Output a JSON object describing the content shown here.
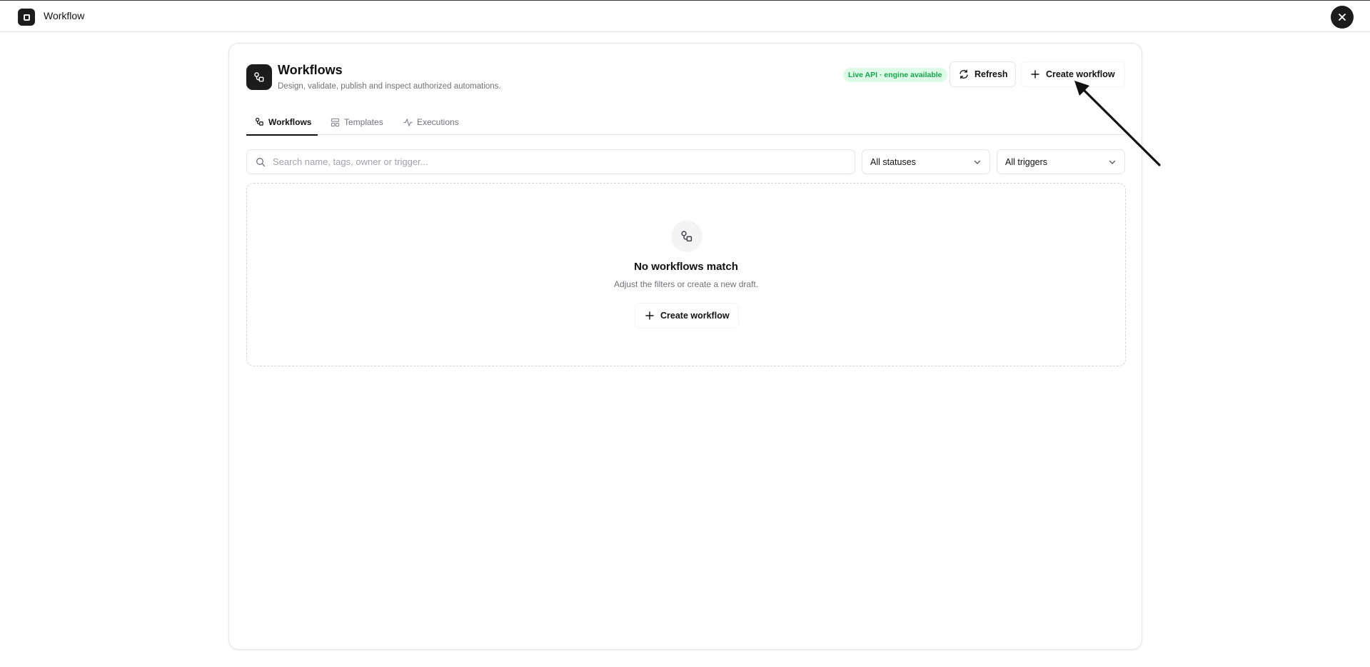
{
  "window": {
    "title": "Workflow",
    "app_icon": "square-icon",
    "close_icon": "close-icon"
  },
  "header": {
    "title": "Workflows",
    "subtitle": "Design, validate, publish and inspect authorized automations.",
    "icon": "workflow-icon",
    "status_badge": "Live API · engine available",
    "refresh_label": "Refresh",
    "create_label": "Create workflow"
  },
  "tabs": [
    {
      "label": "Workflows",
      "icon": "workflow-icon",
      "active": true
    },
    {
      "label": "Templates",
      "icon": "template-icon",
      "active": false
    },
    {
      "label": "Executions",
      "icon": "activity-icon",
      "active": false
    }
  ],
  "filters": {
    "search_placeholder": "Search name, tags, owner or trigger...",
    "search_value": "",
    "status_selected": "All statuses",
    "trigger_selected": "All triggers"
  },
  "empty_state": {
    "title": "No workflows match",
    "message": "Adjust the filters or create a new draft.",
    "button_label": "Create workflow"
  },
  "colors": {
    "accent_dark": "#1c1c1c",
    "badge_bg": "#dcfce7",
    "badge_text": "#16a34a",
    "muted_text": "#71717a",
    "border": "#e4e4e7"
  }
}
